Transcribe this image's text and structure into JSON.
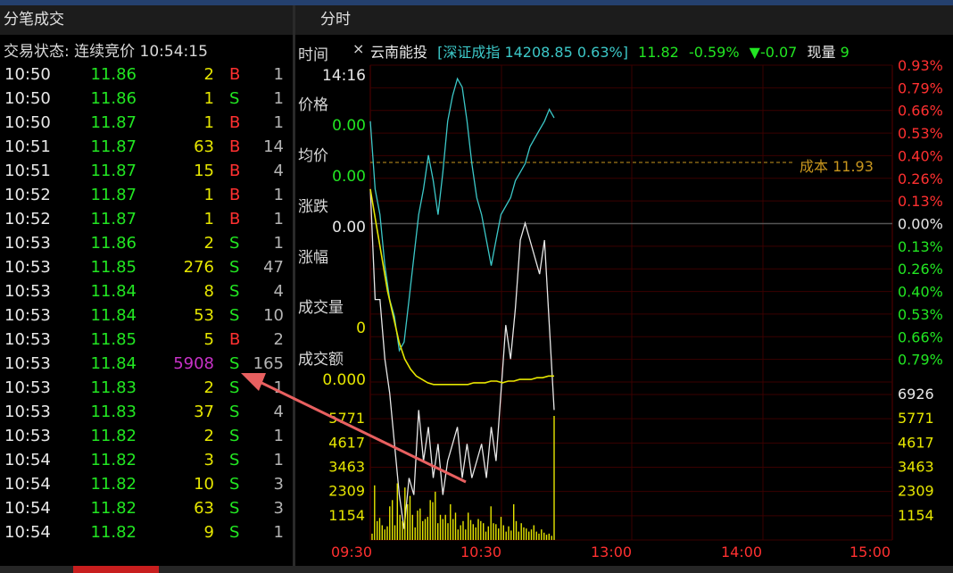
{
  "panels": {
    "left_title": "分笔成交",
    "right_title": "分时"
  },
  "status": {
    "text": "交易状态: 连续竞价 10:54:15"
  },
  "trades": [
    {
      "time": "10:50",
      "price": "11.86",
      "volume": "2",
      "side": "B",
      "count": "1"
    },
    {
      "time": "10:50",
      "price": "11.86",
      "volume": "1",
      "side": "S",
      "count": "1"
    },
    {
      "time": "10:50",
      "price": "11.87",
      "volume": "1",
      "side": "B",
      "count": "1"
    },
    {
      "time": "10:51",
      "price": "11.87",
      "volume": "63",
      "side": "B",
      "count": "14"
    },
    {
      "time": "10:51",
      "price": "11.87",
      "volume": "15",
      "side": "B",
      "count": "4"
    },
    {
      "time": "10:52",
      "price": "11.87",
      "volume": "1",
      "side": "B",
      "count": "1"
    },
    {
      "time": "10:52",
      "price": "11.87",
      "volume": "1",
      "side": "B",
      "count": "1"
    },
    {
      "time": "10:53",
      "price": "11.86",
      "volume": "2",
      "side": "S",
      "count": "1"
    },
    {
      "time": "10:53",
      "price": "11.85",
      "volume": "276",
      "side": "S",
      "count": "47"
    },
    {
      "time": "10:53",
      "price": "11.84",
      "volume": "8",
      "side": "S",
      "count": "4"
    },
    {
      "time": "10:53",
      "price": "11.84",
      "volume": "53",
      "side": "S",
      "count": "10"
    },
    {
      "time": "10:53",
      "price": "11.85",
      "volume": "5",
      "side": "B",
      "count": "2"
    },
    {
      "time": "10:53",
      "price": "11.84",
      "volume": "5908",
      "side": "S",
      "count": "165",
      "highlight": true
    },
    {
      "time": "10:53",
      "price": "11.83",
      "volume": "2",
      "side": "S",
      "count": "1"
    },
    {
      "time": "10:53",
      "price": "11.83",
      "volume": "37",
      "side": "S",
      "count": "4"
    },
    {
      "time": "10:53",
      "price": "11.82",
      "volume": "2",
      "side": "S",
      "count": "1"
    },
    {
      "time": "10:54",
      "price": "11.82",
      "volume": "3",
      "side": "S",
      "count": "1"
    },
    {
      "time": "10:54",
      "price": "11.82",
      "volume": "10",
      "side": "S",
      "count": "3"
    },
    {
      "time": "10:54",
      "price": "11.82",
      "volume": "63",
      "side": "S",
      "count": "3"
    },
    {
      "time": "10:54",
      "price": "11.82",
      "volume": "9",
      "side": "S",
      "count": "1"
    }
  ],
  "info_panel": {
    "time_label": "时间",
    "time_value": "14:16",
    "price_label": "价格",
    "price_value": "0.00",
    "avg_label": "均价",
    "avg_value": "0.00",
    "change_label": "涨跌",
    "change_value": "0.00",
    "pct_label": "涨幅",
    "volume_label": "成交量",
    "volume_value": "0",
    "amount_label": "成交额",
    "amount_value": "0.000"
  },
  "info_bar": {
    "close_glyph": "×",
    "stock_name": "云南能投",
    "index_text": "[深证成指 14208.85 0.63%]",
    "price": "11.82",
    "pct": "-0.59%",
    "change": "▼-0.07",
    "current_label": "现量",
    "current_value": "9"
  },
  "cost_line": {
    "label": "成本 11.93",
    "price": 11.93
  },
  "colors": {
    "up": "#ff3030",
    "down": "#22e622",
    "volume": "#e6e600",
    "price_line": "#3cc8c8",
    "avg_line": "#e6e600",
    "cost_line": "#c8961e",
    "highlight_volume": "#c832c8",
    "arrow": "#e86060"
  },
  "chart_data": [
    {
      "type": "line",
      "x_range": [
        "09:30",
        "15:00"
      ],
      "pct_ticks": [
        "0.93%",
        "0.79%",
        "0.66%",
        "0.53%",
        "0.40%",
        "0.26%",
        "0.13%",
        "0.00%",
        "0.13%",
        "0.26%",
        "0.40%",
        "0.53%",
        "0.66%",
        "0.79%"
      ],
      "ylim_pct": [
        -0.93,
        0.93
      ],
      "series": [
        {
          "values": [
            0.6,
            0.2,
            0.05,
            -0.25,
            -0.45,
            -0.55,
            -0.75,
            -0.7,
            -0.45,
            -0.2,
            0.05,
            0.2,
            0.4,
            0.25,
            0.05,
            0.3,
            0.6,
            0.75,
            0.85,
            0.8,
            0.6,
            0.35,
            0.15,
            0.05,
            -0.1,
            -0.25,
            -0.1,
            0.05,
            0.1,
            0.15,
            0.25,
            0.3,
            0.35,
            0.45,
            0.5,
            0.55,
            0.6,
            0.67,
            0.62
          ]
        },
        {
          "values": [
            0.2,
            -0.45,
            -0.45,
            -0.8,
            -1.0,
            -1.3,
            -1.6,
            -1.8,
            -1.5,
            -1.6,
            -1.1,
            -1.4,
            -1.2,
            -1.5,
            -1.3,
            -1.6,
            -1.4,
            -1.3,
            -1.2,
            -1.5,
            -1.3,
            -1.5,
            -1.4,
            -1.3,
            -1.5,
            -1.2,
            -1.4,
            -1.0,
            -0.6,
            -0.8,
            -0.5,
            -0.1,
            0.0,
            -0.1,
            -0.2,
            -0.3,
            -0.1,
            -0.6,
            -1.1
          ]
        },
        {
          "values": [
            0.2,
            0.0,
            -0.2,
            -0.4,
            -0.55,
            -0.7,
            -0.8,
            -0.86,
            -0.9,
            -0.92,
            -0.94,
            -0.95,
            -0.95,
            -0.95,
            -0.95,
            -0.95,
            -0.95,
            -0.95,
            -0.94,
            -0.94,
            -0.94,
            -0.93,
            -0.93,
            -0.94,
            -0.93,
            -0.93,
            -0.92,
            -0.92,
            -0.92,
            -0.91,
            -0.91,
            -0.9,
            -0.9
          ]
        }
      ]
    },
    {
      "type": "bar",
      "x_range": [
        "09:30",
        "15:00"
      ],
      "y_ticks": [
        "6926",
        "5771",
        "4617",
        "3463",
        "2309",
        "1154"
      ],
      "ylim": [
        0,
        6926
      ],
      "x_ticks": [
        "09:30",
        "10:30",
        "13:00",
        "14:00",
        "15:00"
      ],
      "values": [
        300,
        2600,
        900,
        1050,
        700,
        500,
        650,
        1600,
        1900,
        700,
        2700,
        1200,
        900,
        2500,
        1700,
        2100,
        1200,
        600,
        1400,
        1500,
        900,
        1000,
        1100,
        1900,
        1800,
        2300,
        800,
        1200,
        1000,
        1200,
        800,
        1700,
        1000,
        1300,
        500,
        700,
        900,
        500,
        1300,
        950,
        750,
        600,
        1000,
        900,
        800,
        400,
        650,
        1600,
        800,
        750,
        550,
        1100,
        700,
        400,
        650,
        450,
        1700,
        900,
        400,
        800,
        600,
        550,
        400,
        500,
        700,
        400,
        300,
        500,
        350,
        250,
        300,
        200,
        5908
      ]
    }
  ]
}
